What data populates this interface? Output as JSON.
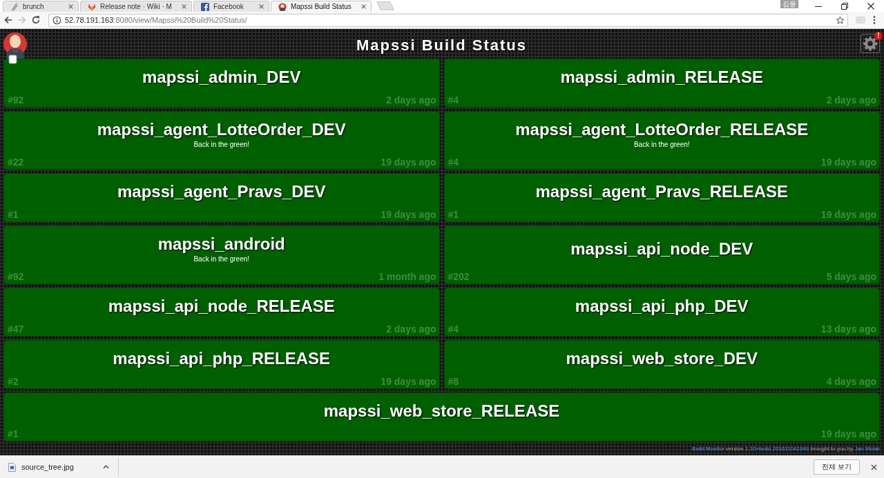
{
  "browser": {
    "tabs": [
      {
        "title": "brunch",
        "kind": "pen",
        "selected": false
      },
      {
        "title": "Release note · Wiki · M",
        "kind": "fox",
        "selected": false
      },
      {
        "title": "Facebook",
        "kind": "fsquare",
        "selected": false
      },
      {
        "title": "Mapssi Build Status",
        "kind": "butler",
        "selected": true
      }
    ],
    "profile": "김웅",
    "nav": {
      "back_disabled": false,
      "forward_disabled": true
    },
    "address": {
      "host": "52.78.191.163",
      "path": ":8080/view/Mapssi%20Build%20Status/"
    }
  },
  "page": {
    "title": "Mapssi Build Status",
    "settings_badge": "!"
  },
  "jobs": [
    {
      "name": "mapssi_admin_DEV",
      "passing": true,
      "build": "#92",
      "time": "2 days ago"
    },
    {
      "name": "mapssi_admin_RELEASE",
      "passing": true,
      "build": "#4",
      "time": "2 days ago"
    },
    {
      "name": "mapssi_agent_LotteOrder_DEV",
      "passing": true,
      "message": "Back in the green!",
      "build": "#22",
      "time": "19 days ago"
    },
    {
      "name": "mapssi_agent_LotteOrder_RELEASE",
      "passing": true,
      "message": "Back in the green!",
      "build": "#4",
      "time": "19 days ago"
    },
    {
      "name": "mapssi_agent_Pravs_DEV",
      "passing": true,
      "build": "#1",
      "time": "19 days ago"
    },
    {
      "name": "mapssi_agent_Pravs_RELEASE",
      "passing": true,
      "build": "#1",
      "time": "19 days ago"
    },
    {
      "name": "mapssi_android",
      "passing": true,
      "message": "Back in the green!",
      "build": "#92",
      "time": "1 month ago"
    },
    {
      "name": "mapssi_api_node_DEV",
      "passing": true,
      "build": "#202",
      "time": "5 days ago"
    },
    {
      "name": "mapssi_api_node_RELEASE",
      "passing": true,
      "build": "#47",
      "time": "2 days ago"
    },
    {
      "name": "mapssi_api_php_DEV",
      "passing": true,
      "build": "#4",
      "time": "13 days ago"
    },
    {
      "name": "mapssi_api_php_RELEASE",
      "passing": true,
      "build": "#2",
      "time": "19 days ago"
    },
    {
      "name": "mapssi_web_store_DEV",
      "passing": true,
      "build": "#8",
      "time": "4 days ago"
    },
    {
      "name": "mapssi_web_store_RELEASE",
      "passing": true,
      "build": "#1",
      "time": "19 days ago"
    }
  ],
  "footer": {
    "parts": [
      {
        "text": "Build Monitor",
        "kind": "link"
      },
      {
        "text": "version",
        "kind": "text"
      },
      {
        "text": "1.10+build.201611041949",
        "kind": "link"
      },
      {
        "text": "brought to you by",
        "kind": "text"
      },
      {
        "text": "Jan Molak",
        "kind": "link"
      }
    ]
  },
  "download_bar": {
    "file": "source_tree.jpg",
    "show_all": "전체 보기"
  }
}
